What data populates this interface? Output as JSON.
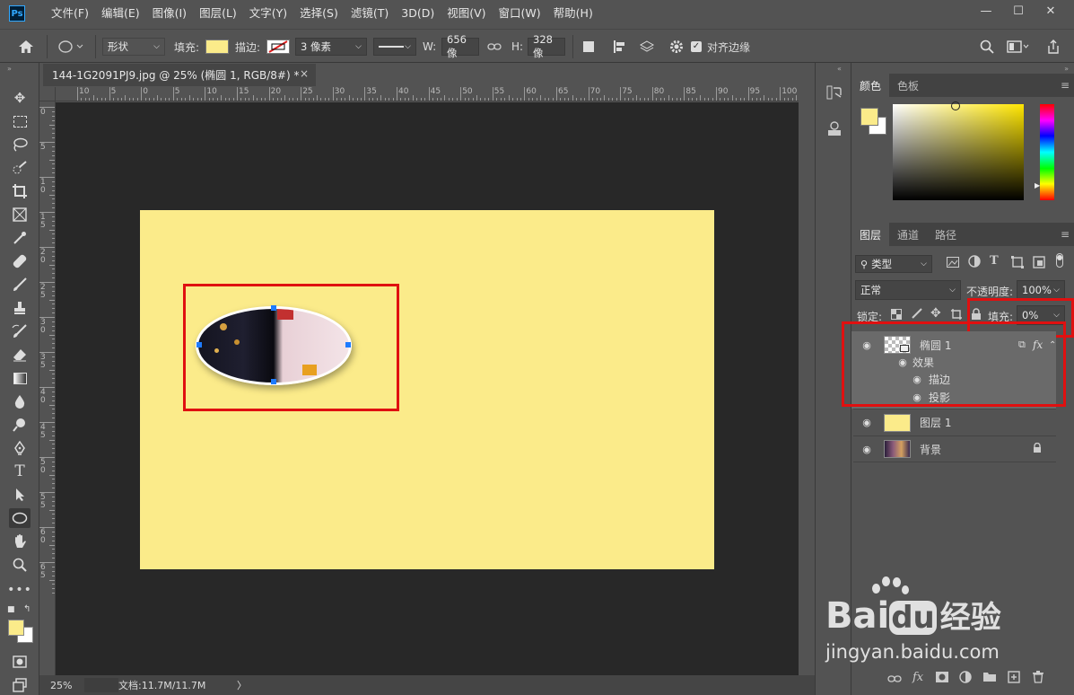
{
  "menubar": {
    "logo": "Ps",
    "items": [
      "文件(F)",
      "编辑(E)",
      "图像(I)",
      "图层(L)",
      "文字(Y)",
      "选择(S)",
      "滤镜(T)",
      "3D(D)",
      "视图(V)",
      "窗口(W)",
      "帮助(H)"
    ],
    "window_controls": [
      "—",
      "☐",
      "✕"
    ]
  },
  "options": {
    "shape_mode": "形状",
    "fill_label": "填充:",
    "fill_color": "#fbeb8a",
    "stroke_label": "描边:",
    "stroke_width": "3 像素",
    "w_label": "W:",
    "w_value": "656 像",
    "h_label": "H:",
    "h_value": "328 像",
    "align_edges_label": "对齐边缘"
  },
  "document": {
    "tab_title": "144-1G2091PJ9.jpg @ 25% (椭圆 1, RGB/8#) *",
    "close": "×",
    "canvas_color": "#fbeb8a",
    "ruler_top_labels": [
      "10",
      "5",
      "0",
      "5",
      "10",
      "15",
      "20",
      "25",
      "30",
      "35",
      "40",
      "45",
      "50",
      "55",
      "60",
      "65",
      "70",
      "75",
      "80",
      "85",
      "90",
      "95",
      "100"
    ],
    "ruler_left_labels": [
      "0",
      "5",
      "1 0",
      "1 5",
      "2 0",
      "2 5",
      "3 0",
      "3 5",
      "4 0",
      "4 5",
      "5 0",
      "5 5",
      "6 0",
      "6 5"
    ]
  },
  "status": {
    "zoom": "25%",
    "doc_size": "文档:11.7M/11.7M",
    "arrow": "〉"
  },
  "color_panel": {
    "tabs": [
      "颜色",
      "色板"
    ],
    "foreground": "#fbeb8a",
    "background": "#ffffff"
  },
  "layers_panel": {
    "tabs": [
      "图层",
      "通道",
      "路径"
    ],
    "filter_kind": "类型",
    "blend_mode": "正常",
    "opacity_label": "不透明度:",
    "opacity_value": "100%",
    "lock_label": "锁定:",
    "fill_label": "填充:",
    "fill_value": "0%",
    "layers": [
      {
        "name": "椭圆  1",
        "effects_label": "效果",
        "effects": [
          "描边",
          "投影"
        ],
        "fx": "fx"
      },
      {
        "name": "图层  1"
      },
      {
        "name": "背景"
      }
    ]
  },
  "watermark": {
    "brand": "Bai",
    "brand_du": "du",
    "suffix": "经验",
    "url": "jingyan.baidu.com"
  }
}
